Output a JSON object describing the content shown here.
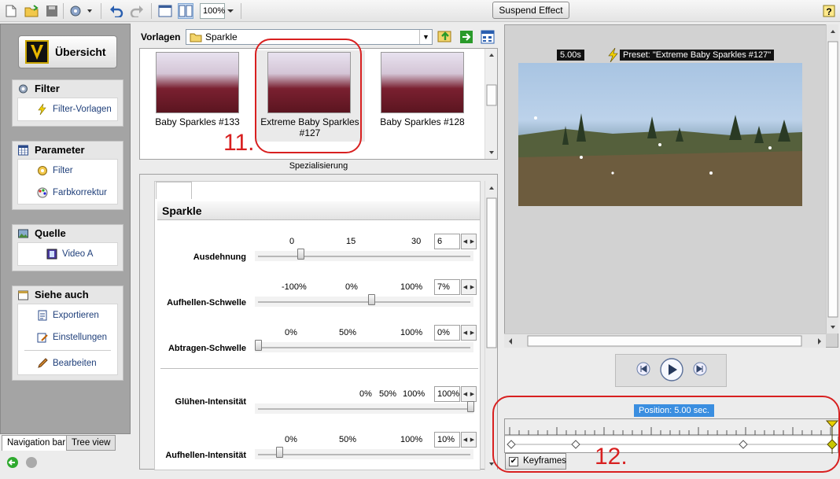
{
  "toolbar": {
    "zoom": "100%",
    "suspend_label": "Suspend Effect"
  },
  "nav": {
    "overview_label": "Übersicht",
    "groups": [
      {
        "title": "Filter",
        "items": [
          "Filter-Vorlagen"
        ]
      },
      {
        "title": "Parameter",
        "items": [
          "Filter",
          "Farbkorrektur"
        ]
      },
      {
        "title": "Quelle",
        "items": [
          "Video A"
        ]
      },
      {
        "title": "Siehe auch",
        "items": [
          "Exportieren",
          "Einstellungen",
          "Bearbeiten"
        ]
      }
    ],
    "tabs": [
      "Navigation bar",
      "Tree view"
    ]
  },
  "presets": {
    "label": "Vorlagen",
    "folder": "Sparkle",
    "items": [
      "Baby Sparkles #133",
      "Extreme Baby Sparkles #127",
      "Baby Sparkles #128"
    ],
    "section_label": "Spezialisierung"
  },
  "params": {
    "title": "Sparkle",
    "rows": [
      {
        "label": "Ausdehnung",
        "ticks": [
          "0",
          "15",
          "30"
        ],
        "value": "6",
        "level": 0.2
      },
      {
        "label": "Aufhellen-Schwelle",
        "ticks": [
          "-100%",
          "0%",
          "100%"
        ],
        "value": "7%",
        "level": 0.535
      },
      {
        "label": "Abtragen-Schwelle",
        "ticks": [
          "0%",
          "50%",
          "100%"
        ],
        "value": "0%",
        "level": 0
      },
      {
        "label": "Glühen-Intensität",
        "ticks": [
          "0%",
          "50%",
          "100%"
        ],
        "value": "100%",
        "level": 1.0
      },
      {
        "label": "Aufhellen-Intensität",
        "ticks": [
          "0%",
          "50%",
          "100%"
        ],
        "value": "10%",
        "level": 0.1
      }
    ]
  },
  "preview": {
    "time": "5.00s",
    "preset": "Preset: \"Extreme Baby Sparkles #127\""
  },
  "timeline": {
    "position": "Position: 5.00 sec.",
    "keyframes_label": "Keyframes",
    "keyframes_checked": true
  },
  "annotations": {
    "label_11": "11.",
    "label_12": "12."
  },
  "colors": {
    "annotation": "#d82020",
    "position_badge": "#3a8ee0",
    "link_text": "#1f3f7a"
  }
}
